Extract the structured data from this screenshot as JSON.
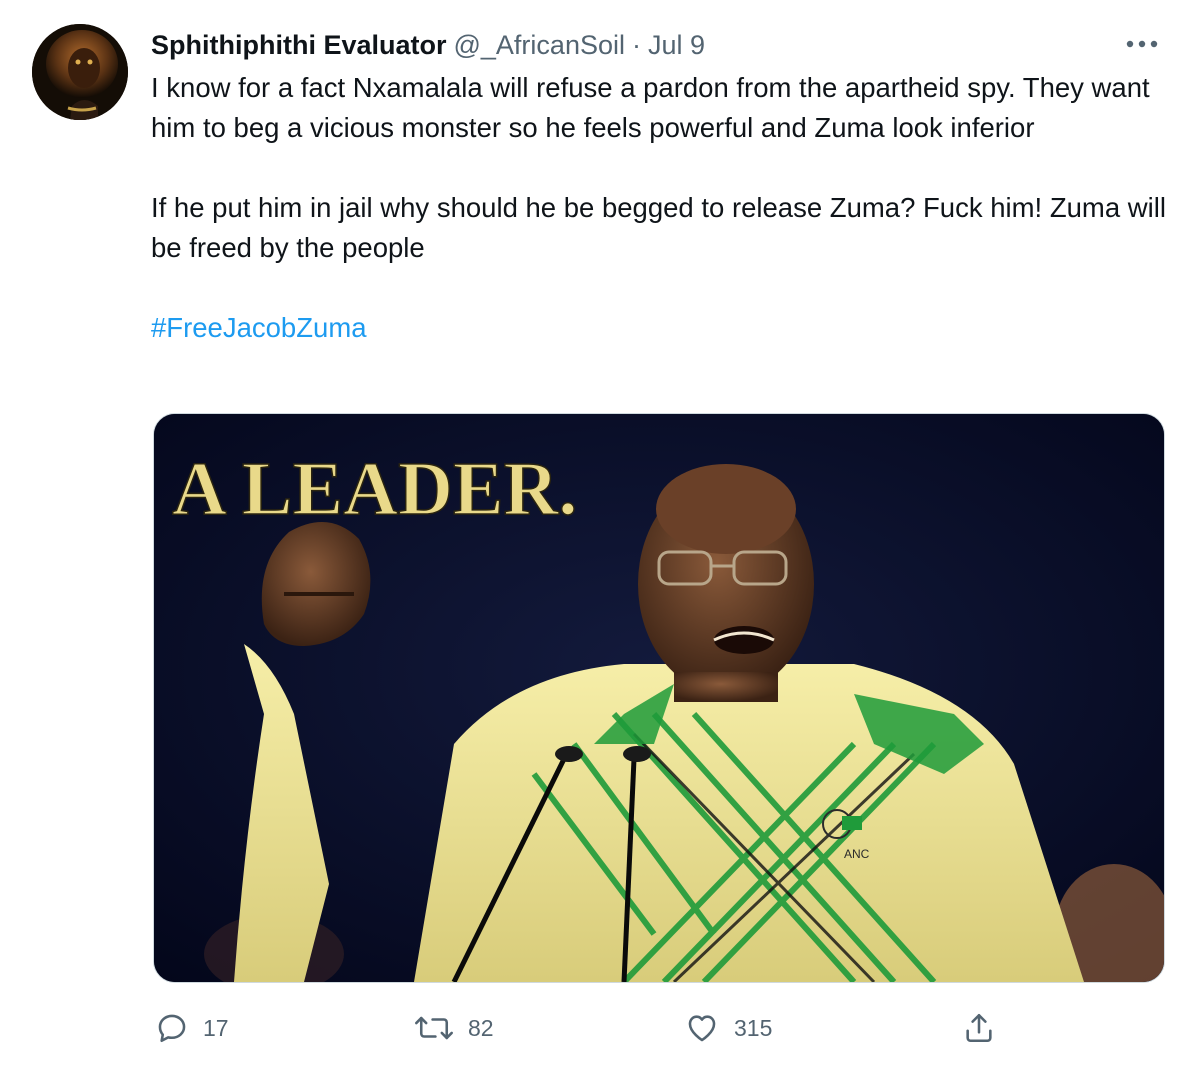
{
  "tweet": {
    "author": {
      "display_name": "Sphithiphithi Evaluator",
      "handle": "@_AfricanSoil",
      "separator": "·",
      "date": "Jul 9",
      "avatar_icon": "lion-avatar"
    },
    "more_icon": "more-icon",
    "body": {
      "line1": "I know for a fact Nxamalala will refuse a pardon from the apartheid spy. They want him to beg a vicious monster so he feels powerful and Zuma look inferior",
      "line2": "If he put him in jail why should he be begged to release Zuma? Fuck him! Zuma will be freed by the people",
      "hashtag": "#FreeJacobZuma"
    },
    "media": {
      "overlay_text": "A LEADER.",
      "badge_text": "ANC",
      "colors": {
        "background": "#05091c",
        "headline": "#e9d98a",
        "shirt": "#f0e79a",
        "stripe_green": "#1f9b3a"
      }
    },
    "actions": {
      "reply": {
        "icon": "reply-icon",
        "count": "17"
      },
      "retweet": {
        "icon": "retweet-icon",
        "count": "82"
      },
      "like": {
        "icon": "heart-icon",
        "count": "315"
      },
      "share": {
        "icon": "share-icon"
      }
    },
    "colors": {
      "link": "#1d9bf0",
      "secondary_text": "#536471",
      "primary_text": "#0f1419"
    }
  }
}
